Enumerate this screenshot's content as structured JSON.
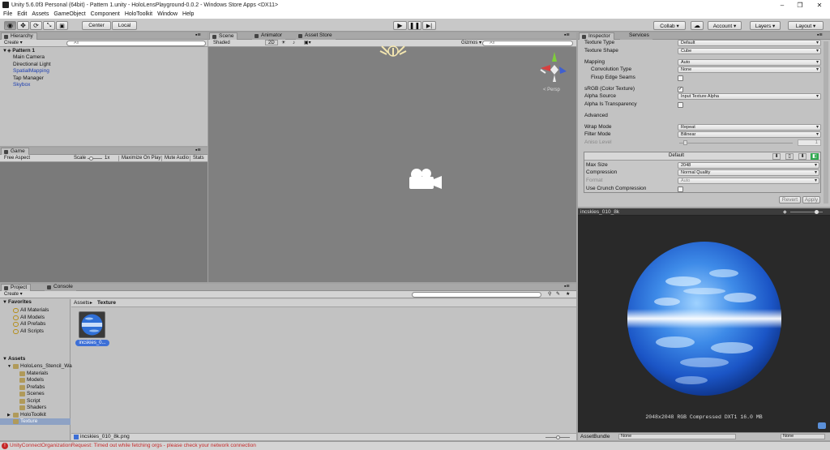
{
  "titlebar": {
    "title": "Unity 5.6.0f3 Personal (64bit) - Pattern 1.unity - HoloLensPlayground-0.0.2 - Windows Store Apps <DX11>",
    "minimize": "–",
    "maximize": "❐",
    "close": "✕"
  },
  "menu": [
    "File",
    "Edit",
    "Assets",
    "GameObject",
    "Component",
    "HoloToolkit",
    "Window",
    "Help"
  ],
  "toolbar": {
    "center": "Center",
    "local": "Local",
    "collab": "Collab ▾",
    "account": "Account ▾",
    "layers": "Layers ▾",
    "layout": "Layout ▾"
  },
  "hierarchy": {
    "tab": "Hierarchy",
    "create": "Create ▾",
    "search": "All",
    "scene": "Pattern 1",
    "items": [
      {
        "label": "Main Camera",
        "color": "#111111"
      },
      {
        "label": "Directional Light",
        "color": "#111111"
      },
      {
        "label": "SpatialMapping",
        "color": "#1a3cb0"
      },
      {
        "label": "Tap Manager",
        "color": "#111111"
      },
      {
        "label": "Skybox",
        "color": "#1a3cb0"
      }
    ]
  },
  "game": {
    "tab": "Game",
    "aspect": "Free Aspect",
    "scale_label": "Scale",
    "scale_value": "1x",
    "maximize": "Maximize On Play",
    "mute": "Mute Audio",
    "stats": "Stats"
  },
  "scene_view": {
    "tabs": [
      "Scene",
      "Animator",
      "Asset Store"
    ],
    "shading": "Shaded",
    "mode2d": "2D",
    "gizmos": "Gizmos ▾",
    "search": "All",
    "persp": "< Persp"
  },
  "inspector": {
    "tabs": [
      "Inspector",
      "Services"
    ],
    "rows": [
      {
        "label": "Texture Type",
        "value": "Default"
      },
      {
        "label": "Texture Shape",
        "value": "Cube"
      },
      {
        "label": "Mapping",
        "value": "Auto"
      },
      {
        "label": "Convolution Type",
        "value": "None"
      },
      {
        "label": "Fixup Edge Seams",
        "value": ""
      },
      {
        "label": "sRGB (Color Texture)",
        "value": "✓"
      },
      {
        "label": "Alpha Source",
        "value": "Input Texture Alpha"
      },
      {
        "label": "Alpha Is Transparency",
        "value": ""
      },
      {
        "label": "Advanced",
        "value": ""
      },
      {
        "label": "Wrap Mode",
        "value": "Repeat"
      },
      {
        "label": "Filter Mode",
        "value": "Bilinear"
      },
      {
        "label": "Aniso Level",
        "value": "1"
      }
    ],
    "platform": {
      "header": "Default",
      "rows": [
        {
          "label": "Max Size",
          "value": "2048"
        },
        {
          "label": "Compression",
          "value": "Normal Quality"
        },
        {
          "label": "Format",
          "value": "Auto"
        },
        {
          "label": "Use Crunch Compression",
          "value": ""
        }
      ]
    },
    "revert": "Revert",
    "apply": "Apply"
  },
  "preview": {
    "title": "incskies_010_8k",
    "info": "2048x2048  RGB Compressed DXT1   16.0 MB",
    "assetbundle_label": "AssetBundle",
    "bundle_value": "None",
    "variant_value": "None"
  },
  "project": {
    "tabs": [
      "Project",
      "Console"
    ],
    "create": "Create ▾",
    "favorites": {
      "label": "Favorites",
      "items": [
        "All Materials",
        "All Models",
        "All Prefabs",
        "All Scripts"
      ]
    },
    "assets": {
      "label": "Assets",
      "items": [
        {
          "label": "HoloLens_Stencil_Wa",
          "level": 1
        },
        {
          "label": "Materials",
          "level": 2
        },
        {
          "label": "Models",
          "level": 2
        },
        {
          "label": "Prefabs",
          "level": 2
        },
        {
          "label": "Scenes",
          "level": 2
        },
        {
          "label": "Script",
          "level": 2
        },
        {
          "label": "Shaders",
          "level": 2
        },
        {
          "label": "HoloToolkit",
          "level": 1
        },
        {
          "label": "Texture",
          "level": 1
        }
      ]
    },
    "breadcrumb": {
      "root": "Assets",
      "sep": "▸",
      "current": "Texture"
    },
    "asset": {
      "label": "incskies_0..."
    },
    "footer_file": "incskies_010_8k.png"
  },
  "status": {
    "message": "UnityConnectOrganizationRequest: Timed out while fetching orgs - please check your network connection",
    "color": "#c62828"
  },
  "colors": {
    "accent": "#3d6fd6",
    "scene_bg": "#808080",
    "preview_bg": "#2a2a2a"
  }
}
